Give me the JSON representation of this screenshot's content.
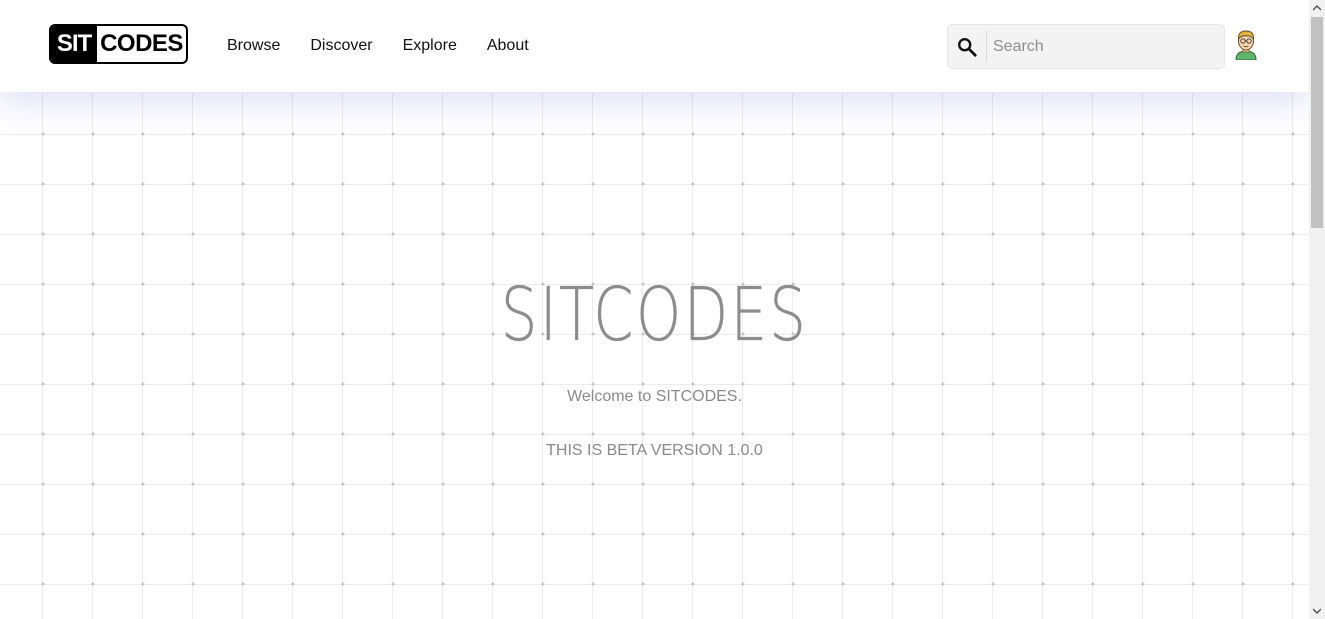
{
  "header": {
    "logo": {
      "part1": "SIT",
      "part2": "CODES"
    },
    "nav": [
      {
        "label": "Browse"
      },
      {
        "label": "Discover"
      },
      {
        "label": "Explore"
      },
      {
        "label": "About"
      }
    ],
    "search": {
      "placeholder": "Search",
      "value": "",
      "icon": "search-icon"
    },
    "avatar": {
      "icon": "user-avatar-icon"
    }
  },
  "hero": {
    "title": "SITCODES",
    "welcome": "Welcome to SITCODES.",
    "beta": "THIS IS BETA VERSION 1.0.0"
  },
  "colors": {
    "grid_line": "#ececec",
    "grid_dot": "#c4c4c4",
    "hero_text": "#8a8a8a",
    "nav_shadow": "#7878dc"
  }
}
